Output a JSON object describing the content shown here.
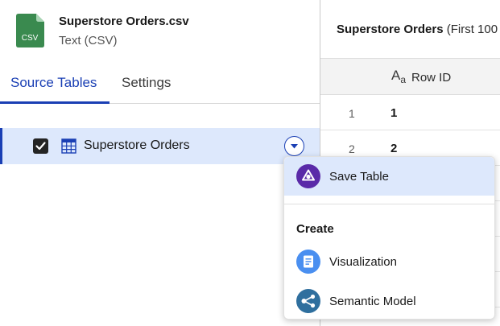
{
  "file": {
    "icon": "csv-file-icon",
    "icon_label": "CSV",
    "name": "Superstore Orders.csv",
    "type": "Text (CSV)",
    "color": "#3a8a4f"
  },
  "tabs": [
    {
      "label": "Source Tables",
      "active": true
    },
    {
      "label": "Settings",
      "active": false
    }
  ],
  "source_tables": [
    {
      "label": "Superstore Orders",
      "checked": true,
      "icon": "table-grid-icon"
    }
  ],
  "preview": {
    "title": "Superstore Orders",
    "subtitle": "(First 100",
    "column": {
      "type_icon": "text-type-icon",
      "type_glyph": "A",
      "type_glyph_small": "a",
      "name": "Row ID"
    },
    "rows": [
      {
        "num": "1",
        "value": "1"
      },
      {
        "num": "2",
        "value": "2"
      }
    ]
  },
  "menu": {
    "items_top": [
      {
        "label": "Save Table",
        "icon": "save-table-icon",
        "color": "#5a2aa8"
      }
    ],
    "section_label": "Create",
    "items_create": [
      {
        "label": "Visualization",
        "icon": "visualization-icon",
        "color": "#4a8ff0"
      },
      {
        "label": "Semantic Model",
        "icon": "semantic-model-icon",
        "color": "#2f6f9e"
      }
    ]
  },
  "colors": {
    "accent": "#1a3fb4",
    "selected_bg": "#dde8fc"
  }
}
